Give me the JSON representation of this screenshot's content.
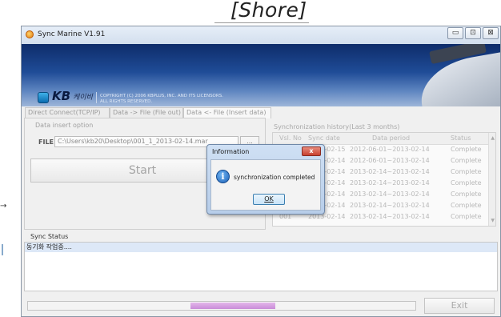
{
  "annotation": {
    "label": "[Shore]"
  },
  "window": {
    "title": "Sync Marine V1.91",
    "controls": {
      "minimize": "▭",
      "maximize": "⊡",
      "close": "⊠"
    }
  },
  "banner": {
    "logo_text": "KB",
    "logo_sub": "케이비",
    "copyright": "COPYRIGHT (C) 2006 KBPLUS, INC. AND ITS LICENSORS.\nALL RIGHTS RESERVED."
  },
  "tabs": [
    {
      "label": "Direct Connect(TCP/IP)"
    },
    {
      "label": "Data -> File (File out)"
    },
    {
      "label": "Data <- File (Insert data)"
    }
  ],
  "left_panel": {
    "group_title": "Data insert option",
    "file_label": "FILE",
    "file_value": "C:\\Users\\kb20\\Desktop\\001_1_2013-02-14.mar",
    "browse_label": "...",
    "start_label": "Start"
  },
  "history": {
    "group_title": "Synchronization history(Last 3 months)",
    "columns": [
      "Vsl. No",
      "Sync date",
      "Data period",
      "Status"
    ],
    "rows": [
      {
        "vsl": "",
        "sync_date": "2013-02-15",
        "period": "2012-06-01~2013-02-14",
        "status": "Complete"
      },
      {
        "vsl": "",
        "sync_date": "2013-02-14",
        "period": "2012-06-01~2013-02-14",
        "status": "Complete"
      },
      {
        "vsl": "",
        "sync_date": "2013-02-14",
        "period": "2013-02-14~2013-02-14",
        "status": "Complete"
      },
      {
        "vsl": "",
        "sync_date": "2013-02-14",
        "period": "2013-02-14~2013-02-14",
        "status": "Complete"
      },
      {
        "vsl": "",
        "sync_date": "2013-02-14",
        "period": "2013-02-14~2013-02-14",
        "status": "Complete"
      },
      {
        "vsl": "",
        "sync_date": "2013-02-14",
        "period": "2013-02-14~2013-02-14",
        "status": "Complete"
      },
      {
        "vsl": "001",
        "sync_date": "2013-02-14",
        "period": "2013-02-14~2013-02-14",
        "status": "Complete"
      }
    ]
  },
  "dialog": {
    "title": "Information",
    "close_label": "x",
    "message": "synchronization completed",
    "ok_label": "OK"
  },
  "sync_status": {
    "title": "Sync Status",
    "lines": [
      "동기화 작업중...."
    ]
  },
  "footer": {
    "progress_fraction": 0.22,
    "progress_offset_fraction": 0.42,
    "exit_label": "Exit"
  },
  "colors": {
    "banner_dark": "#0e2c6a",
    "progress": "#c98cd8",
    "selection": "#dde8f7"
  }
}
